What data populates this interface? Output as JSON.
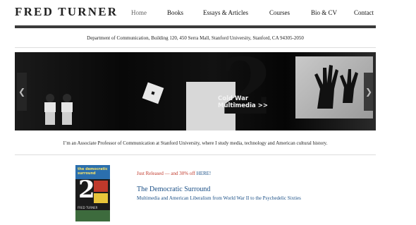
{
  "site": {
    "title": "FRED TURNER"
  },
  "nav": {
    "items": [
      {
        "label": "Home",
        "active": true
      },
      {
        "label": "Books"
      },
      {
        "label": "Essays & Articles"
      },
      {
        "label": "Courses"
      },
      {
        "label": "Bio & CV"
      },
      {
        "label": "Contact"
      }
    ]
  },
  "address": "Department of Communication, Building 120, 450 Serra Mall, Stanford University, Stanford, CA 94305-2050",
  "hero": {
    "caption_line1": "Cold War",
    "caption_line2": "Multimedia >>",
    "prev_arrow": "❮",
    "next_arrow": "❯",
    "prev_icon": "chevron-left-icon",
    "next_icon": "chevron-right-icon"
  },
  "bio": "I’m an Associate Professor of Communication at Stanford University, where I study media, technology and American cultural history.",
  "feature": {
    "promo_prefix": "Just Released — and 30% off ",
    "promo_link": "HERE!",
    "title": "The Democratic Surround",
    "subtitle": "Multimedia and American Liberalism from World War II to the Psychedelic Sixties",
    "cover": {
      "title_line1": "the democratic",
      "title_line2": "surround",
      "number": "2",
      "author": "FRED TURNER"
    }
  },
  "colors": {
    "link": "#1a4f86",
    "promo": "#c0392b",
    "rule": "#3a3a3a"
  }
}
